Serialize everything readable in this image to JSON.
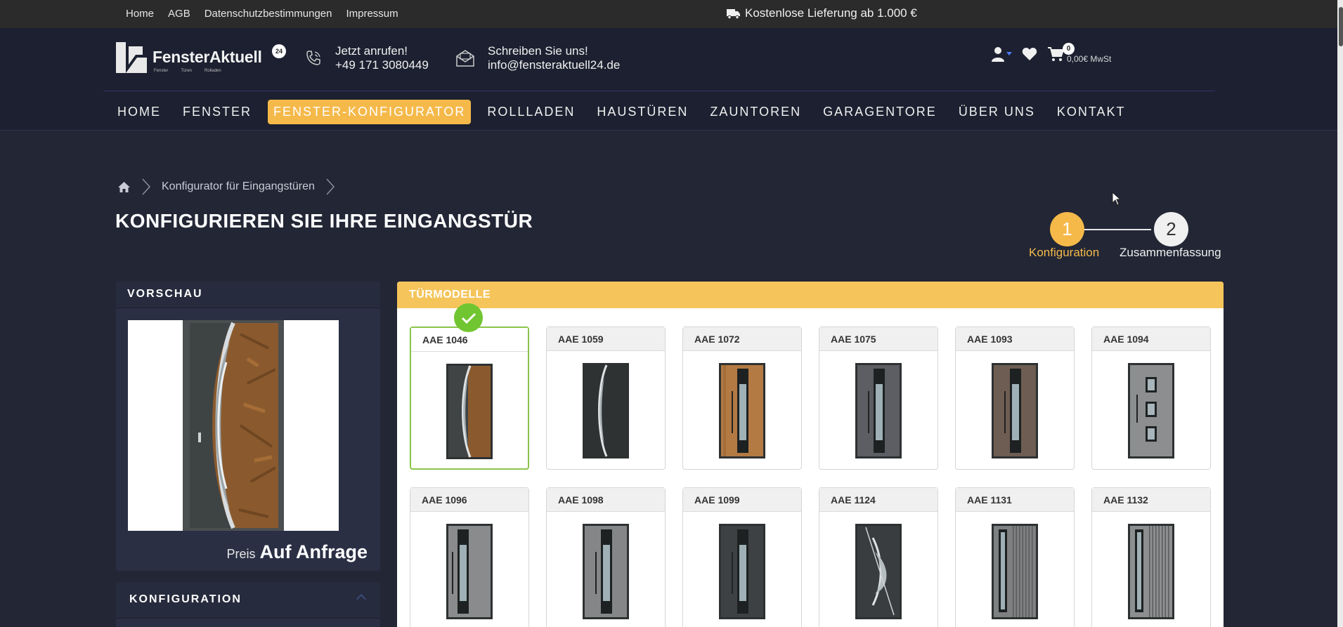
{
  "topbar": {
    "links": [
      "Home",
      "AGB",
      "Datenschutzbestimmungen",
      "Impressum"
    ],
    "delivery_text": "Kostenlose Lieferung ab 1.000 €",
    "delivery_icon": "truck-icon"
  },
  "header": {
    "logo_text": "FensterAktuell",
    "logo_badge": "24",
    "logo_sub": [
      "Fenster",
      "Türen",
      "Rolladen"
    ],
    "phone_label": "Jetzt anrufen!",
    "phone_number": "+49 171 3080449",
    "email_label": "Schreiben Sie uns!",
    "email_address": "info@fensteraktuell24.de",
    "cart_count": "0",
    "cart_total": "0,00€ MwSt"
  },
  "nav": {
    "items": [
      "HOME",
      "FENSTER",
      "FENSTER-KONFIGURATOR",
      "ROLLLADEN",
      "HAUSTÜREN",
      "ZAUNTOREN",
      "GARAGENTORE",
      "ÜBER UNS",
      "KONTAKT"
    ],
    "active_index": 2
  },
  "breadcrumb": {
    "home_icon": "home-icon",
    "items": [
      "Konfigurator für Eingangstüren"
    ]
  },
  "page": {
    "title": "KONFIGURIEREN SIE IHRE EINGANGSTÜR"
  },
  "steps": [
    {
      "number": "1",
      "label": "Konfiguration",
      "active": true
    },
    {
      "number": "2",
      "label": "Zusammenfassung",
      "active": false
    }
  ],
  "preview": {
    "heading": "VORSCHAU",
    "price_label": "Preis",
    "price_value": "Auf Anfrage"
  },
  "configuration": {
    "heading": "KONFIGURATION"
  },
  "models": {
    "heading": "TÜRMODELLE",
    "selected_index": 0,
    "items": [
      {
        "name": "AAE 1046",
        "style": "wood-arc"
      },
      {
        "name": "AAE 1059",
        "style": "dark-arc"
      },
      {
        "name": "AAE 1072",
        "style": "wood-strip"
      },
      {
        "name": "AAE 1075",
        "style": "grey-strip"
      },
      {
        "name": "AAE 1093",
        "style": "brown-strip"
      },
      {
        "name": "AAE 1094",
        "style": "grey-three"
      },
      {
        "name": "AAE 1096",
        "style": "grey-strip-left"
      },
      {
        "name": "AAE 1098",
        "style": "grey-strip-mid"
      },
      {
        "name": "AAE 1099",
        "style": "dark-grey-strip"
      },
      {
        "name": "AAE 1124",
        "style": "dark-arc-right"
      },
      {
        "name": "AAE 1131",
        "style": "grey-grooves"
      },
      {
        "name": "AAE 1132",
        "style": "grey-grooves-left"
      }
    ]
  },
  "colors": {
    "accent": "#f5b94a",
    "background": "#222635",
    "selected": "#71c530"
  }
}
